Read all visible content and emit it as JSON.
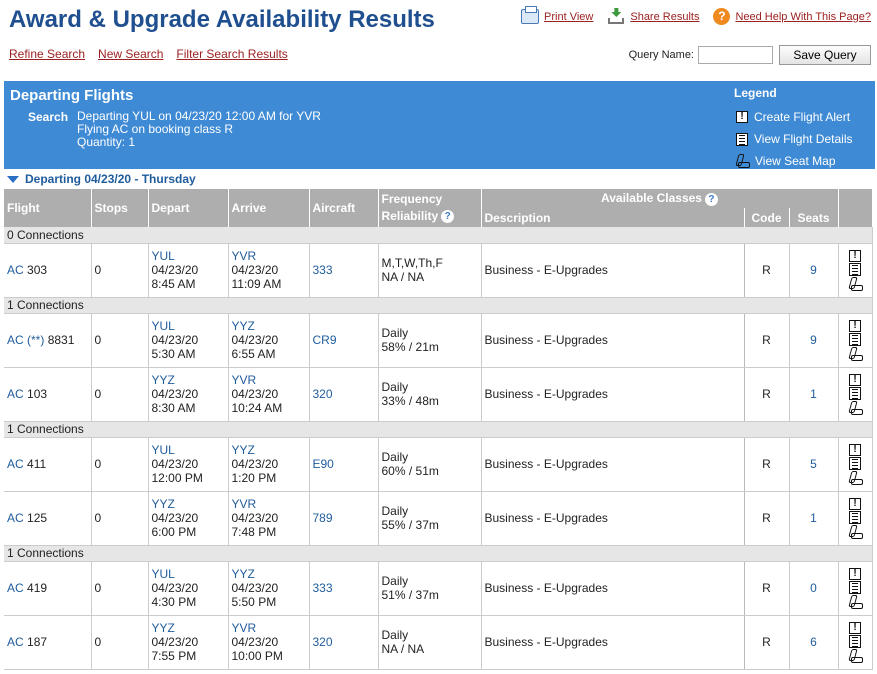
{
  "header": {
    "title": "Award & Upgrade Availability Results",
    "print_view": "Print View",
    "share_results": "Share Results",
    "need_help": "Need Help With This Page?",
    "refine_search": "Refine Search",
    "new_search": "New Search",
    "filter_results": "Filter Search Results",
    "query_name_label": "Query Name:",
    "query_name_value": "",
    "save_query": "Save Query"
  },
  "banner": {
    "title": "Departing Flights",
    "search_label": "Search",
    "search_line1": "Departing YUL on 04/23/20 12:00 AM for YVR",
    "search_line2": "Flying AC on booking class R",
    "search_line3": "Quantity: 1",
    "legend_title": "Legend",
    "legend_alert": "Create Flight Alert",
    "legend_details": "View Flight Details",
    "legend_seatmap": "View Seat Map"
  },
  "departing_header": "Departing 04/23/20 - Thursday",
  "columns": {
    "flight": "Flight",
    "stops": "Stops",
    "depart": "Depart",
    "arrive": "Arrive",
    "aircraft": "Aircraft",
    "frequency": "Frequency",
    "reliability": "Reliability",
    "available_classes": "Available Classes",
    "description": "Description",
    "code": "Code",
    "seats": "Seats"
  },
  "groups": [
    {
      "label": "0 Connections",
      "rows": [
        {
          "airline": "AC",
          "flight": "303",
          "stops": "0",
          "dep_code": "YUL",
          "dep_date": "04/23/20",
          "dep_time": "8:45 AM",
          "arr_code": "YVR",
          "arr_date": "04/23/20",
          "arr_time": "11:09 AM",
          "aircraft": "333",
          "freq": "M,T,W,Th,F",
          "rel": "NA / NA",
          "desc": "Business - E-Upgrades",
          "code": "R",
          "seats": "9"
        }
      ]
    },
    {
      "label": "1 Connections",
      "rows": [
        {
          "airline": "AC (**)",
          "flight": "8831",
          "stops": "0",
          "dep_code": "YUL",
          "dep_date": "04/23/20",
          "dep_time": "5:30 AM",
          "arr_code": "YYZ",
          "arr_date": "04/23/20",
          "arr_time": "6:55 AM",
          "aircraft": "CR9",
          "freq": "Daily",
          "rel": "58% / 21m",
          "desc": "Business - E-Upgrades",
          "code": "R",
          "seats": "9"
        },
        {
          "airline": "AC",
          "flight": "103",
          "stops": "0",
          "dep_code": "YYZ",
          "dep_date": "04/23/20",
          "dep_time": "8:30 AM",
          "arr_code": "YVR",
          "arr_date": "04/23/20",
          "arr_time": "10:24 AM",
          "aircraft": "320",
          "freq": "Daily",
          "rel": "33% / 48m",
          "desc": "Business - E-Upgrades",
          "code": "R",
          "seats": "1"
        }
      ]
    },
    {
      "label": "1 Connections",
      "rows": [
        {
          "airline": "AC",
          "flight": "411",
          "stops": "0",
          "dep_code": "YUL",
          "dep_date": "04/23/20",
          "dep_time": "12:00 PM",
          "arr_code": "YYZ",
          "arr_date": "04/23/20",
          "arr_time": "1:20 PM",
          "aircraft": "E90",
          "freq": "Daily",
          "rel": "60% / 51m",
          "desc": "Business - E-Upgrades",
          "code": "R",
          "seats": "5"
        },
        {
          "airline": "AC",
          "flight": "125",
          "stops": "0",
          "dep_code": "YYZ",
          "dep_date": "04/23/20",
          "dep_time": "6:00 PM",
          "arr_code": "YVR",
          "arr_date": "04/23/20",
          "arr_time": "7:48 PM",
          "aircraft": "789",
          "freq": "Daily",
          "rel": "55% / 37m",
          "desc": "Business - E-Upgrades",
          "code": "R",
          "seats": "1"
        }
      ]
    },
    {
      "label": "1 Connections",
      "rows": [
        {
          "airline": "AC",
          "flight": "419",
          "stops": "0",
          "dep_code": "YUL",
          "dep_date": "04/23/20",
          "dep_time": "4:30 PM",
          "arr_code": "YYZ",
          "arr_date": "04/23/20",
          "arr_time": "5:50 PM",
          "aircraft": "333",
          "freq": "Daily",
          "rel": "51% / 37m",
          "desc": "Business - E-Upgrades",
          "code": "R",
          "seats": "0"
        },
        {
          "airline": "AC",
          "flight": "187",
          "stops": "0",
          "dep_code": "YYZ",
          "dep_date": "04/23/20",
          "dep_time": "7:55 PM",
          "arr_code": "YVR",
          "arr_date": "04/23/20",
          "arr_time": "10:00 PM",
          "aircraft": "320",
          "freq": "Daily",
          "rel": "NA / NA",
          "desc": "Business - E-Upgrades",
          "code": "R",
          "seats": "6"
        }
      ]
    }
  ]
}
